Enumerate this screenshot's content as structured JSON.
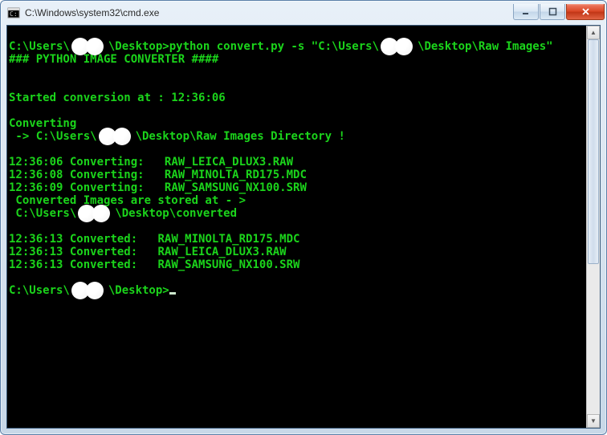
{
  "window": {
    "title": "C:\\Windows\\system32\\cmd.exe"
  },
  "prompt": {
    "prefix": "C:\\Users\\",
    "suffix": "\\Desktop>",
    "command": "python convert.py -s \"C:\\Users\\",
    "command_tail": "\\Desktop\\Raw Images\""
  },
  "banner": "### PYTHON IMAGE CONVERTER ####",
  "started_label": "Started conversion at : ",
  "started_time": "12:36:06",
  "converting_header": "Converting",
  "converting_path_prefix": " -> C:\\Users\\",
  "converting_path_suffix": "\\Desktop\\Raw Images Directory !",
  "convert_lines": [
    {
      "time": "12:36:06",
      "label": "Converting:",
      "file": "RAW_LEICA_DLUX3.RAW"
    },
    {
      "time": "12:36:08",
      "label": "Converting:",
      "file": "RAW_MINOLTA_RD175.MDC"
    },
    {
      "time": "12:36:09",
      "label": "Converting:",
      "file": "RAW_SAMSUNG_NX100.SRW"
    }
  ],
  "stored_label": " Converted Images are stored at - >",
  "stored_path_prefix": " C:\\Users\\",
  "stored_path_suffix": "\\Desktop\\converted",
  "converted_lines": [
    {
      "time": "12:36:13",
      "label": "Converted:",
      "file": "RAW_MINOLTA_RD175.MDC"
    },
    {
      "time": "12:36:13",
      "label": "Converted:",
      "file": "RAW_LEICA_DLUX3.RAW"
    },
    {
      "time": "12:36:13",
      "label": "Converted:",
      "file": "RAW_SAMSUNG_NX100.SRW"
    }
  ],
  "final_prompt_prefix": "C:\\Users\\",
  "final_prompt_suffix": "\\Desktop>"
}
